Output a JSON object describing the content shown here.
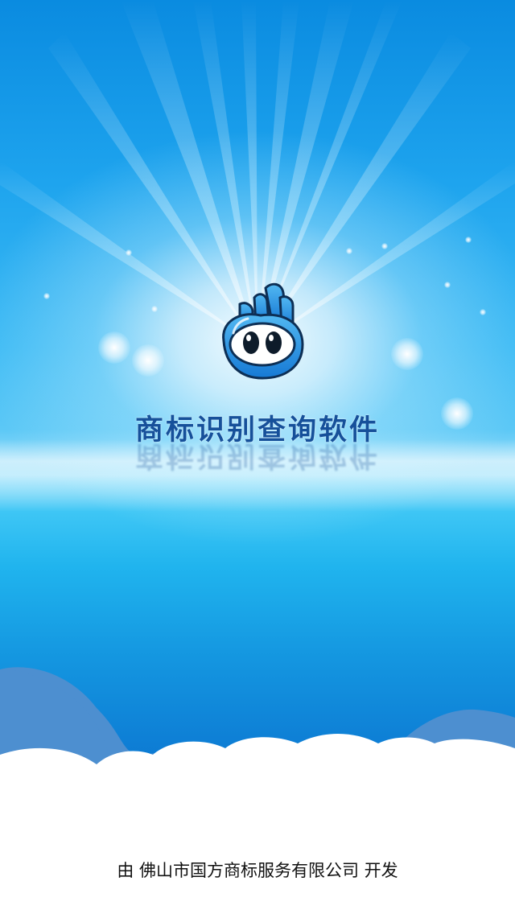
{
  "app": {
    "title": "商标识别查询软件",
    "developer_credit": "由 佛山市国方商标服务有限公司 开发"
  },
  "icons": {
    "logo": "mascot-logo-icon"
  },
  "colors": {
    "sky_top": "#0a8be0",
    "sky_bottom": "#0a66c6",
    "title_text": "#16509a",
    "cloud_front": "#ffffff",
    "cloud_back": "#4d8fd0"
  }
}
